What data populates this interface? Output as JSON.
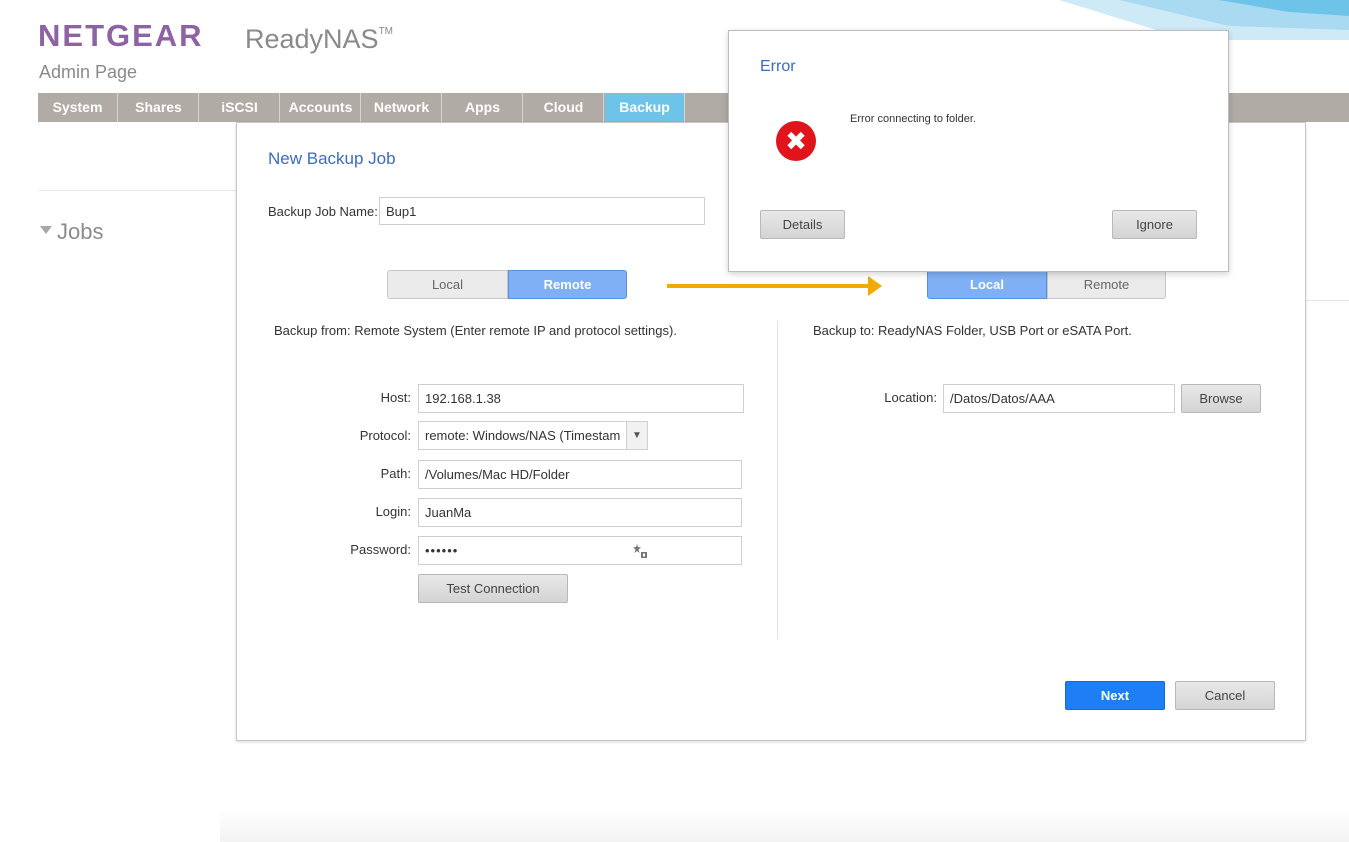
{
  "header": {
    "brand": "NETGEAR",
    "product": "ReadyNAS",
    "trademark": "TM",
    "subtitle": "Admin Page"
  },
  "nav": {
    "tabs": [
      "System",
      "Shares",
      "iSCSI",
      "Accounts",
      "Network",
      "Apps",
      "Cloud",
      "Backup"
    ],
    "active": "Backup"
  },
  "page": {
    "section_title": "Jobs"
  },
  "backup_dialog": {
    "title": "New Backup Job",
    "job_name_label": "Backup Job Name:",
    "job_name_value": "Bup1",
    "source": {
      "toggle": {
        "local": "Local",
        "remote": "Remote",
        "selected": "Remote"
      },
      "description": "Backup from: Remote System (Enter remote IP and protocol settings).",
      "host_label": "Host:",
      "host_value": "192.168.1.38",
      "protocol_label": "Protocol:",
      "protocol_value": "remote: Windows/NAS (Timestam",
      "path_label": "Path:",
      "path_value": "/Volumes/Mac HD/Folder",
      "login_label": "Login:",
      "login_value": "JuanMa",
      "password_label": "Password:",
      "password_masked": "••••••",
      "test_button": "Test Connection"
    },
    "destination": {
      "toggle": {
        "local": "Local",
        "remote": "Remote",
        "selected": "Local"
      },
      "description": "Backup to: ReadyNAS Folder, USB Port or eSATA Port.",
      "location_label": "Location:",
      "location_value": "/Datos/Datos/AAA",
      "browse_button": "Browse"
    },
    "next_button": "Next",
    "cancel_button": "Cancel"
  },
  "error_dialog": {
    "title": "Error",
    "message": "Error connecting to folder.",
    "details_button": "Details",
    "ignore_button": "Ignore",
    "icon": "error-x-icon"
  },
  "colors": {
    "brand_purple": "#8e63a5",
    "nav_gray": "#b1aba5",
    "active_tab": "#6ec4e8",
    "title_blue": "#3a6cc4",
    "primary_button": "#1e7ef5",
    "toggle_on": "#7fb0f5",
    "annotation_arrow": "#f0aa00",
    "error_red": "#e0141a"
  }
}
